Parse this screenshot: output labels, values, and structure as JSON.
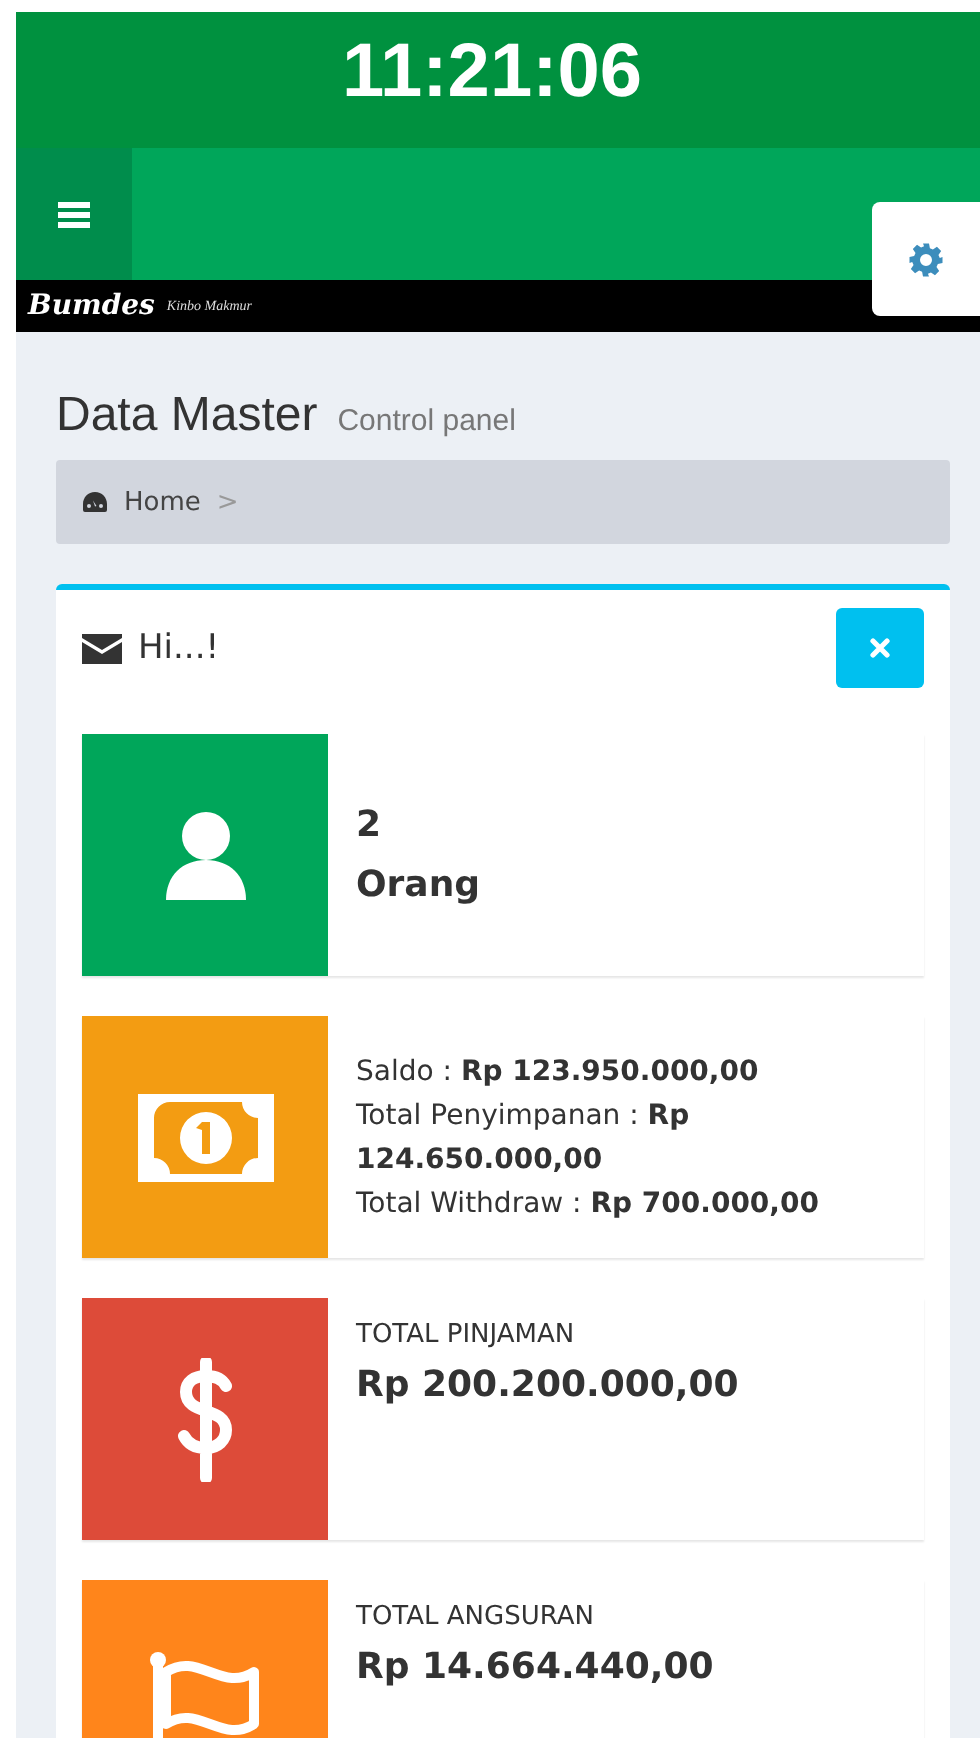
{
  "clock": "11:21:06",
  "brand": {
    "name": "Bumdes",
    "tagline": "Kinbo Makmur"
  },
  "header": {
    "title": "Data Master",
    "subtitle": "Control panel"
  },
  "breadcrumb": {
    "items": [
      "Home"
    ],
    "separator": ">"
  },
  "box": {
    "title": "Hi...!",
    "info_boxes": [
      {
        "kind": "count",
        "color": "#00a65a",
        "number": "2",
        "unit": "Orang"
      },
      {
        "kind": "lines",
        "color": "#f39c12",
        "lines": [
          "Saldo : **Rp 123.950.000,00**",
          "Total Penyimpanan : **Rp 124.650.000,00**",
          "Total Withdraw : **Rp 700.000,00**"
        ]
      },
      {
        "kind": "stat",
        "color": "#dd4b39",
        "label": "TOTAL PINJAMAN",
        "value": "Rp 200.200.000,00"
      },
      {
        "kind": "stat",
        "color": "#ff851b",
        "label": "TOTAL ANGSURAN",
        "value": "Rp 14.664.440,00"
      }
    ]
  }
}
